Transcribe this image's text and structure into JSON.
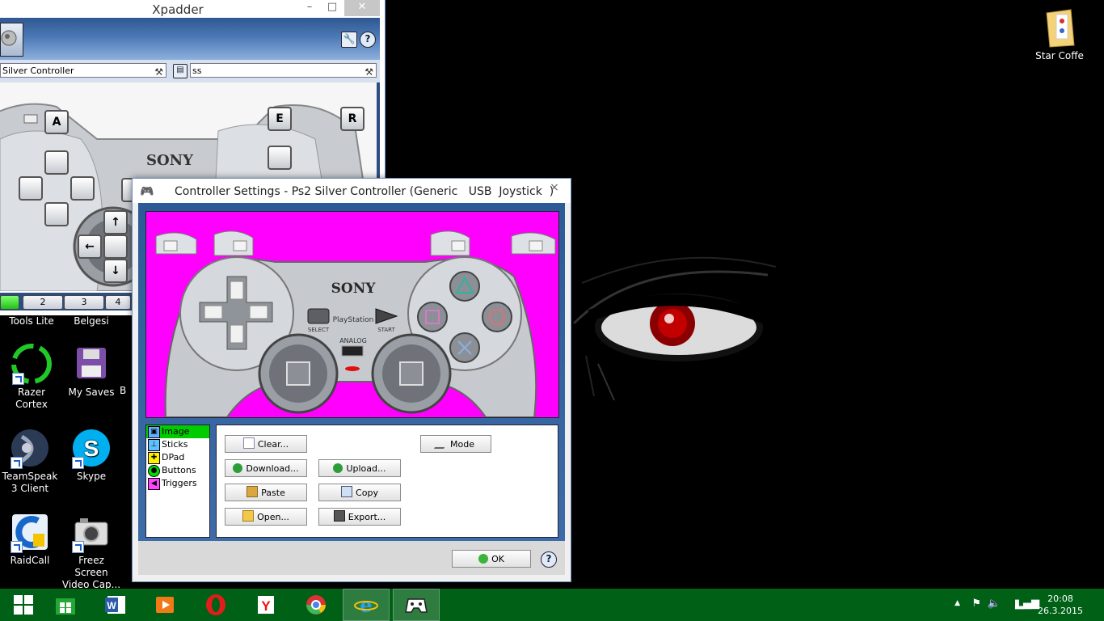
{
  "xpadder": {
    "title": "Xpadder",
    "controller_combo": "Silver Controller",
    "profile_combo": "ss",
    "button_labels": [
      "A",
      "E",
      "R"
    ],
    "set_tabs": [
      "2",
      "3",
      "4"
    ]
  },
  "dialog": {
    "title": "Controller Settings - Ps2 Silver Controller (Generic   USB  Joystick  )",
    "close": "×",
    "image_text": {
      "brand": "SONY",
      "platform": "PlayStation",
      "select": "SELECT",
      "start": "START",
      "analog": "ANALOG"
    },
    "categories": [
      {
        "label": "Image",
        "selected": true
      },
      {
        "label": "Sticks",
        "selected": false
      },
      {
        "label": "DPad",
        "selected": false
      },
      {
        "label": "Buttons",
        "selected": false
      },
      {
        "label": "Triggers",
        "selected": false
      }
    ],
    "buttons": {
      "clear": "Clear...",
      "mode": "Mode",
      "download": "Download...",
      "upload": "Upload...",
      "paste": "Paste",
      "copy": "Copy",
      "open": "Open...",
      "export": "Export...",
      "ok": "OK",
      "help": "?"
    }
  },
  "desktop_icons": [
    {
      "label": "Tools Lite"
    },
    {
      "label": "Belgesi"
    },
    {
      "label": "Razer Cortex"
    },
    {
      "label": "My Saves"
    },
    {
      "label": "B"
    },
    {
      "label": "TeamSpeak 3 Client"
    },
    {
      "label": "Skype"
    },
    {
      "label": "RaidCall"
    },
    {
      "label": "Freez Screen Video Cap..."
    },
    {
      "label": "Star Coffe"
    }
  ],
  "taskbar": {
    "apps": [
      "start",
      "store",
      "word",
      "media-player",
      "opera",
      "yandex",
      "chrome",
      "internet-explorer",
      "xpadder"
    ],
    "time": "20:08",
    "date": "26.3.2015"
  },
  "colors": {
    "taskbar": "#006016",
    "dialog_bg": "#ff00ff",
    "selected": "#00cc00",
    "toolbar": "#3d6ca8"
  }
}
